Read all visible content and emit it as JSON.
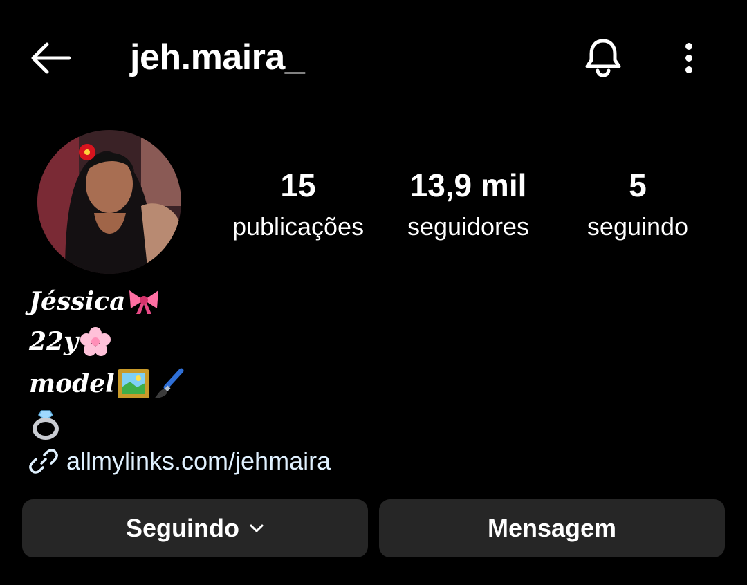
{
  "header": {
    "username": "jeh.maira_",
    "back_icon": "arrow-left-icon",
    "notifications_icon": "bell-icon",
    "more_icon": "more-vertical-icon"
  },
  "profile": {
    "avatar_icon": "profile-photo",
    "stats": [
      {
        "value": "15",
        "label": "publicações"
      },
      {
        "value": "13,9 mil",
        "label": "seguidores"
      },
      {
        "value": "5",
        "label": "seguindo"
      }
    ],
    "bio": {
      "line1": "Jéssica",
      "line1_emoji": "ribbon-emoji",
      "line2": "22y",
      "line2_emoji": "cherry-blossom-emoji",
      "line3": "model",
      "line3_emojis": [
        "framed-picture-emoji",
        "paintbrush-emoji"
      ],
      "line4_emoji": "ring-emoji"
    },
    "link": {
      "icon": "link-icon",
      "text": "allmylinks.com/jehmaira"
    }
  },
  "actions": {
    "following_label": "Seguindo",
    "following_icon": "chevron-down-icon",
    "message_label": "Mensagem"
  },
  "colors": {
    "background": "#000000",
    "text": "#ffffff",
    "link": "#e0f1ff",
    "button_bg": "#262626"
  }
}
